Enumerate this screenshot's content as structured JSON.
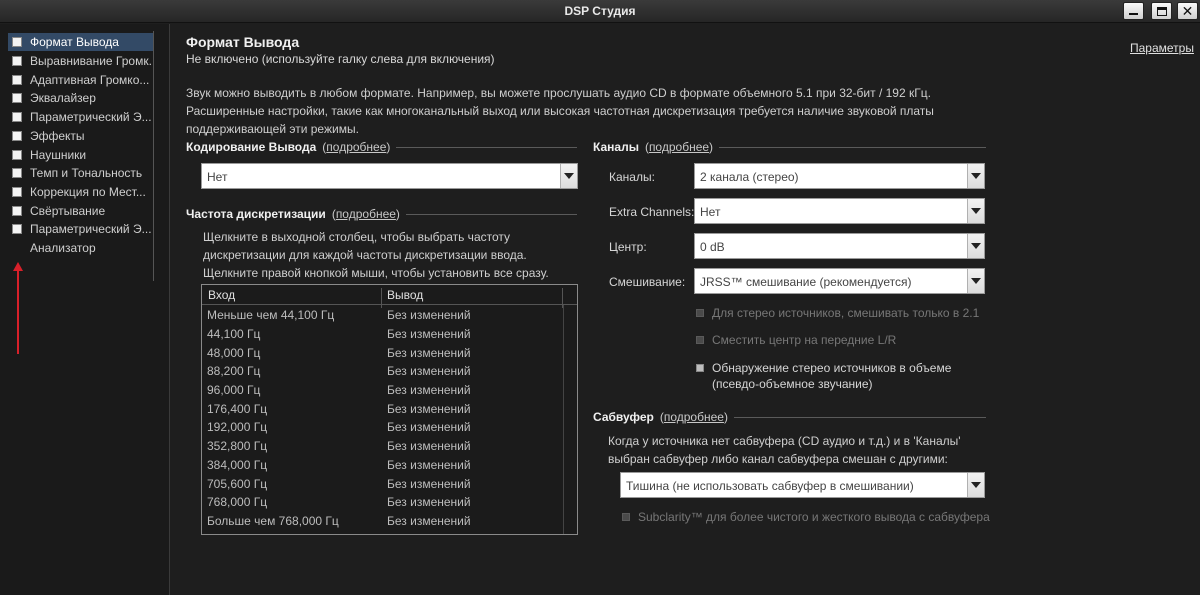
{
  "window": {
    "title": "DSP Студия",
    "minimize": "—",
    "maximize": "□",
    "close": "✕"
  },
  "sidebar": {
    "items": [
      {
        "label": "Формат Вывода",
        "active": true
      },
      {
        "label": "Выравнивание Громк..."
      },
      {
        "label": "Адаптивная Громко..."
      },
      {
        "label": "Эквалайзер"
      },
      {
        "label": "Параметрический Э..."
      },
      {
        "label": "Эффекты"
      },
      {
        "label": "Наушники"
      },
      {
        "label": "Темп и Тональность"
      },
      {
        "label": "Коррекция по Мест..."
      },
      {
        "label": "Свёртывание"
      },
      {
        "label": "Параметрический Э..."
      },
      {
        "label": "Анализатор"
      }
    ]
  },
  "header": {
    "title": "Формат Вывода",
    "subtitle": "Не включено (используйте галку слева для включения)",
    "params_link": "Параметры"
  },
  "intro": {
    "line1": "Звук можно выводить в любом формате. Например, вы можете прослушать аудио CD в формате объемного 5.1 при 32-бит / 192 кГц.",
    "line2": "Расширенные настройки, такие как многоканальный выход или высокая частотная дискретизация требуется наличие звуковой платы",
    "line3": "поддерживающей эти режимы."
  },
  "encoding": {
    "heading": "Кодирование Вывода",
    "more": "подробнее",
    "value": "Нет"
  },
  "samplerate": {
    "heading": "Частота дискретизации",
    "more": "подробнее",
    "desc1": "Щелкните в выходной столбец, чтобы выбрать частоту",
    "desc2": "дискретизации для каждой частоты дискретизации ввода.",
    "desc3": "Щелкните правой кнопкой мыши, чтобы установить все сразу.",
    "col_in": "Вход",
    "col_out": "Вывод",
    "rows": [
      {
        "in": "Меньше чем 44,100 Гц",
        "out": "Без изменений"
      },
      {
        "in": "44,100 Гц",
        "out": "Без изменений"
      },
      {
        "in": "48,000 Гц",
        "out": "Без изменений"
      },
      {
        "in": "88,200 Гц",
        "out": "Без изменений"
      },
      {
        "in": "96,000 Гц",
        "out": "Без изменений"
      },
      {
        "in": "176,400 Гц",
        "out": "Без изменений"
      },
      {
        "in": "192,000 Гц",
        "out": "Без изменений"
      },
      {
        "in": "352,800 Гц",
        "out": "Без изменений"
      },
      {
        "in": "384,000 Гц",
        "out": "Без изменений"
      },
      {
        "in": "705,600 Гц",
        "out": "Без изменений"
      },
      {
        "in": "768,000 Гц",
        "out": "Без изменений"
      },
      {
        "in": "Больше чем 768,000 Гц",
        "out": "Без изменений"
      }
    ]
  },
  "channels": {
    "heading": "Каналы",
    "more": "подробнее",
    "channels_label": "Каналы:",
    "channels_value": "2 канала (стерео)",
    "extra_label": "Extra Channels:",
    "extra_value": "Нет",
    "center_label": "Центр:",
    "center_value": "0 dB",
    "mix_label": "Смешивание:",
    "mix_value": "JRSS™ смешивание (рекомендуется)",
    "opt_stereo21": "Для стерео источников, смешивать только в 2.1",
    "opt_center_lr": "Сместить центр на передние L/R",
    "opt_detect1": "Обнаружение стерео источников в объеме",
    "opt_detect2": "(псевдо-объемное звучание)"
  },
  "subwoofer": {
    "heading": "Сабвуфер",
    "more": "подробнее",
    "desc1": "Когда у источника нет сабвуфера (CD аудио и т.д.) и в 'Каналы'",
    "desc2": "выбран сабвуфер либо канал сабвуфера смешан с другими:",
    "value": "Тишина (не использовать сабвуфер в смешивании)",
    "subclarity": "Subclarity™ для более чистого и жесткого вывода с сабвуфера"
  },
  "colors": {
    "accent": "#334a66",
    "arrow": "#d8202a",
    "background": "#1e1e1e"
  },
  "icons": {
    "annotation": "red-arrow-icon",
    "dropdown": "chevron-down-icon"
  }
}
